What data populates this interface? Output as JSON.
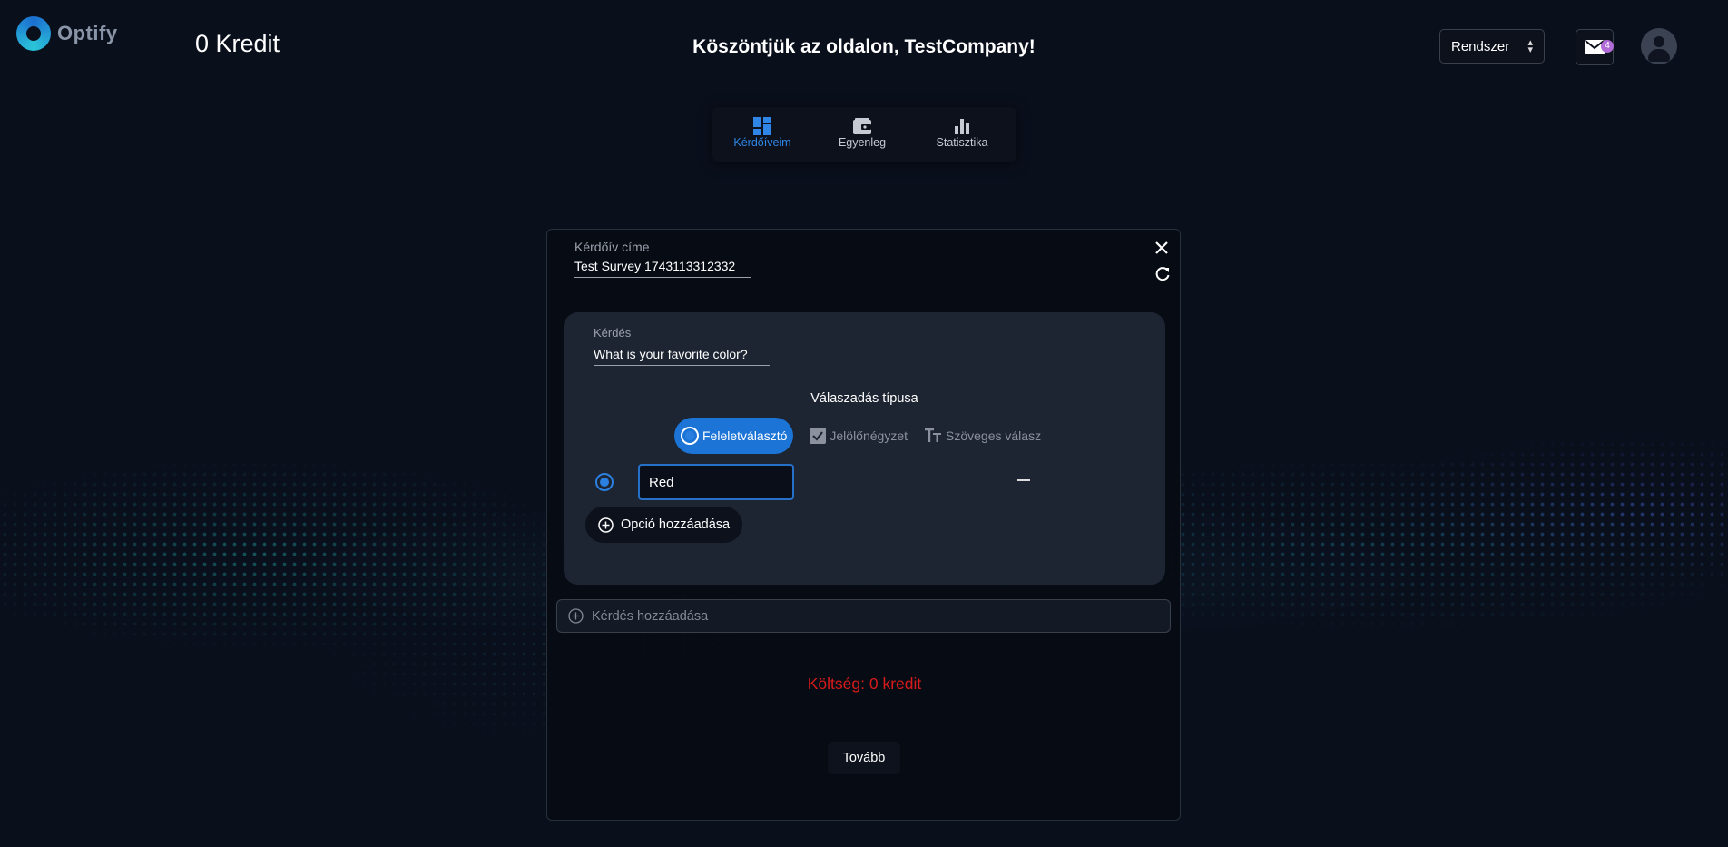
{
  "header": {
    "logo_text": "Optify",
    "credit": "0 Kredit",
    "welcome": "Köszöntjük az oldalon, TestCompany!",
    "system_select": "Rendszer",
    "mail_badge": "4"
  },
  "tabs": [
    {
      "label": "Kérdőíveim",
      "icon": "dashboard-icon",
      "active": true
    },
    {
      "label": "Egyenleg",
      "icon": "wallet-icon",
      "active": false
    },
    {
      "label": "Statisztika",
      "icon": "bar-chart-icon",
      "active": false
    }
  ],
  "survey": {
    "title_label": "Kérdőív címe",
    "title_value": "Test Survey 1743113312332",
    "question_label": "Kérdés",
    "question_value": "What is your favorite color?",
    "answer_type_label": "Válaszadás típusa",
    "answer_types": [
      "Feleletválasztó",
      "Jelölőnégyzet",
      "Szöveges válasz"
    ],
    "selected_answer_type": "Feleletválasztó",
    "option_value": "Red",
    "add_option_label": "Opció hozzáadása",
    "add_question_placeholder": "Kérdés hozzáadása",
    "cost_text": "Költség: 0 kredit",
    "next_label": "Tovább"
  },
  "colors": {
    "accent": "#1b74d6",
    "cost": "#d71b1b",
    "background": "#0a0f1c",
    "badge": "#b06bd6"
  }
}
